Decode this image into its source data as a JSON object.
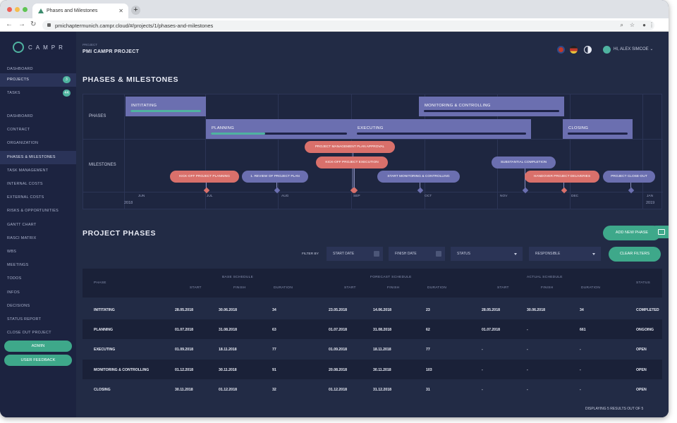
{
  "browser": {
    "tab_title": "Phases and Milestones",
    "url": "pmichaptermunich.campr.cloud/#/projects/1/phases-and-milestones"
  },
  "sidebar": {
    "logo_text": "CAMPR",
    "top_items": [
      {
        "label": "Dashboard"
      },
      {
        "label": "Projects",
        "badge": "3"
      },
      {
        "label": "Tasks",
        "badge": "44"
      }
    ],
    "items": [
      {
        "label": "Dashboard"
      },
      {
        "label": "Contract"
      },
      {
        "label": "Organization"
      },
      {
        "label": "Phases & Milestones"
      },
      {
        "label": "Task Management"
      },
      {
        "label": "Internal Costs"
      },
      {
        "label": "External Costs"
      },
      {
        "label": "Risks & Opportunities"
      },
      {
        "label": "Gantt Chart"
      },
      {
        "label": "RASCI Matrix"
      },
      {
        "label": "WBS"
      },
      {
        "label": "Meetings"
      },
      {
        "label": "Todos"
      },
      {
        "label": "Infos"
      },
      {
        "label": "Decisions"
      },
      {
        "label": "Status Report"
      },
      {
        "label": "Close Out Project"
      }
    ],
    "admin_label": "Admin",
    "feedback_label": "User Feedback"
  },
  "header": {
    "project_label": "Project",
    "project_name": "PMI CAMPR PROJECT",
    "greeting": "HI, ALEX SIMCOE"
  },
  "timeline": {
    "title": "PHASES & MILESTONES",
    "phases_label": "PHASES",
    "milestones_label": "MILESTONES",
    "phases": [
      {
        "name": "INITITATING",
        "progress": 1.0
      },
      {
        "name": "MONITORING & CONTROLLING",
        "progress": 0
      },
      {
        "name": "PLANNING",
        "progress": 0.4
      },
      {
        "name": "EXECUTING",
        "progress": 0
      },
      {
        "name": "CLOSING",
        "progress": 0
      }
    ],
    "milestones": [
      {
        "name": "PROJECT MANAGEMENT PLAN APPROVAL",
        "color": "#d9706b"
      },
      {
        "name": "KICK-OFF PROJECT EXECUTION",
        "color": "#d9706b"
      },
      {
        "name": "KICK-OFF PROJECT PLANNING",
        "color": "#d9706b"
      },
      {
        "name": "1. REVIEW OF PROJECT PLAN",
        "color": "#6b6fb0"
      },
      {
        "name": "START MONITORING & CONTROLLING",
        "color": "#6b6fb0"
      },
      {
        "name": "SUBSTANTIAL COMPLETION",
        "color": "#6b6fb0"
      },
      {
        "name": "HANDOVER PROJECT DELIVERIES",
        "color": "#d9706b"
      },
      {
        "name": "PROJECT CLOSE-OUT",
        "color": "#6b6fb0"
      }
    ],
    "months": [
      "JUN",
      "JUL",
      "AUG",
      "SEP",
      "OCT",
      "NOV",
      "DEC",
      "JAN"
    ],
    "years": [
      "2018",
      "2019"
    ]
  },
  "phases_section": {
    "title": "PROJECT PHASES",
    "add_button": "ADD NEW PHASE",
    "filter_label": "FILTER BY",
    "filter_start": "START DATE",
    "filter_finish": "FINISH DATE",
    "filter_status": "STATUS",
    "filter_responsible": "RESPONSIBLE",
    "clear_button": "CLEAR FILTERS",
    "group_headers": [
      "BASE SCHEDULE",
      "FORECAST SCHEDULE",
      "ACTUAL SCHEDULE"
    ],
    "col_headers": {
      "phase": "PHASE",
      "start": "START",
      "finish": "FINISH",
      "duration": "DURATION",
      "status": "STATUS"
    },
    "rows": [
      [
        "INITITATING",
        "28.05.2018",
        "30.06.2018",
        "34",
        "23.05.2018",
        "14.06.2018",
        "23",
        "28.05.2018",
        "30.06.2018",
        "34",
        "COMPLETED"
      ],
      [
        "PLANNING",
        "01.07.2018",
        "31.08.2018",
        "63",
        "01.07.2018",
        "31.08.2018",
        "62",
        "01.07.2018",
        "-",
        "661",
        "ONGOING"
      ],
      [
        "EXECUTING",
        "01.09.2018",
        "18.11.2018",
        "77",
        "01.09.2018",
        "18.11.2018",
        "77",
        "-",
        "-",
        "-",
        "OPEN"
      ],
      [
        "MONITORING & CONTROLLING",
        "01.12.2018",
        "30.11.2018",
        "91",
        "20.08.2018",
        "30.11.2018",
        "103",
        "-",
        "-",
        "-",
        "OPEN"
      ],
      [
        "CLOSING",
        "30.11.2018",
        "01.12.2018",
        "32",
        "01.12.2018",
        "31.12.2018",
        "31",
        "-",
        "-",
        "-",
        "OPEN"
      ]
    ],
    "footer": "DISPLAYING 5 RESULTS OUT OF 5"
  }
}
